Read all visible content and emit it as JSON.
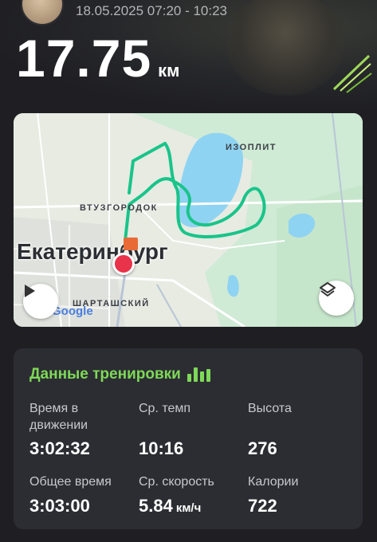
{
  "header": {
    "date_range": "18.05.2025 07:20 - 10:23",
    "distance_value": "17.75",
    "distance_unit": "км"
  },
  "map": {
    "labels": {
      "izoplit": "ИЗОПЛИТ",
      "vtuzgorodok": "ВТУЗГОРОДОК",
      "city": "Екатеринбург",
      "shartashsky": "ШАРТАШСКИЙ"
    },
    "attribution": "Google",
    "route_color": "#19c48a"
  },
  "stats": {
    "title": "Данные тренировки",
    "moving_time_label": "Время в движении",
    "moving_time_value": "3:02:32",
    "avg_pace_label": "Ср. темп",
    "avg_pace_value": "10:16",
    "elevation_label": "Высота",
    "elevation_value": "276",
    "total_time_label": "Общее время",
    "total_time_value": "3:03:00",
    "avg_speed_label": "Ср. скорость",
    "avg_speed_value": "5.84",
    "avg_speed_unit": "км/ч",
    "calories_label": "Калории",
    "calories_value": "722"
  },
  "colors": {
    "accent_green": "#7ed957",
    "background": "#1f1f23",
    "card": "#2c2d33"
  }
}
